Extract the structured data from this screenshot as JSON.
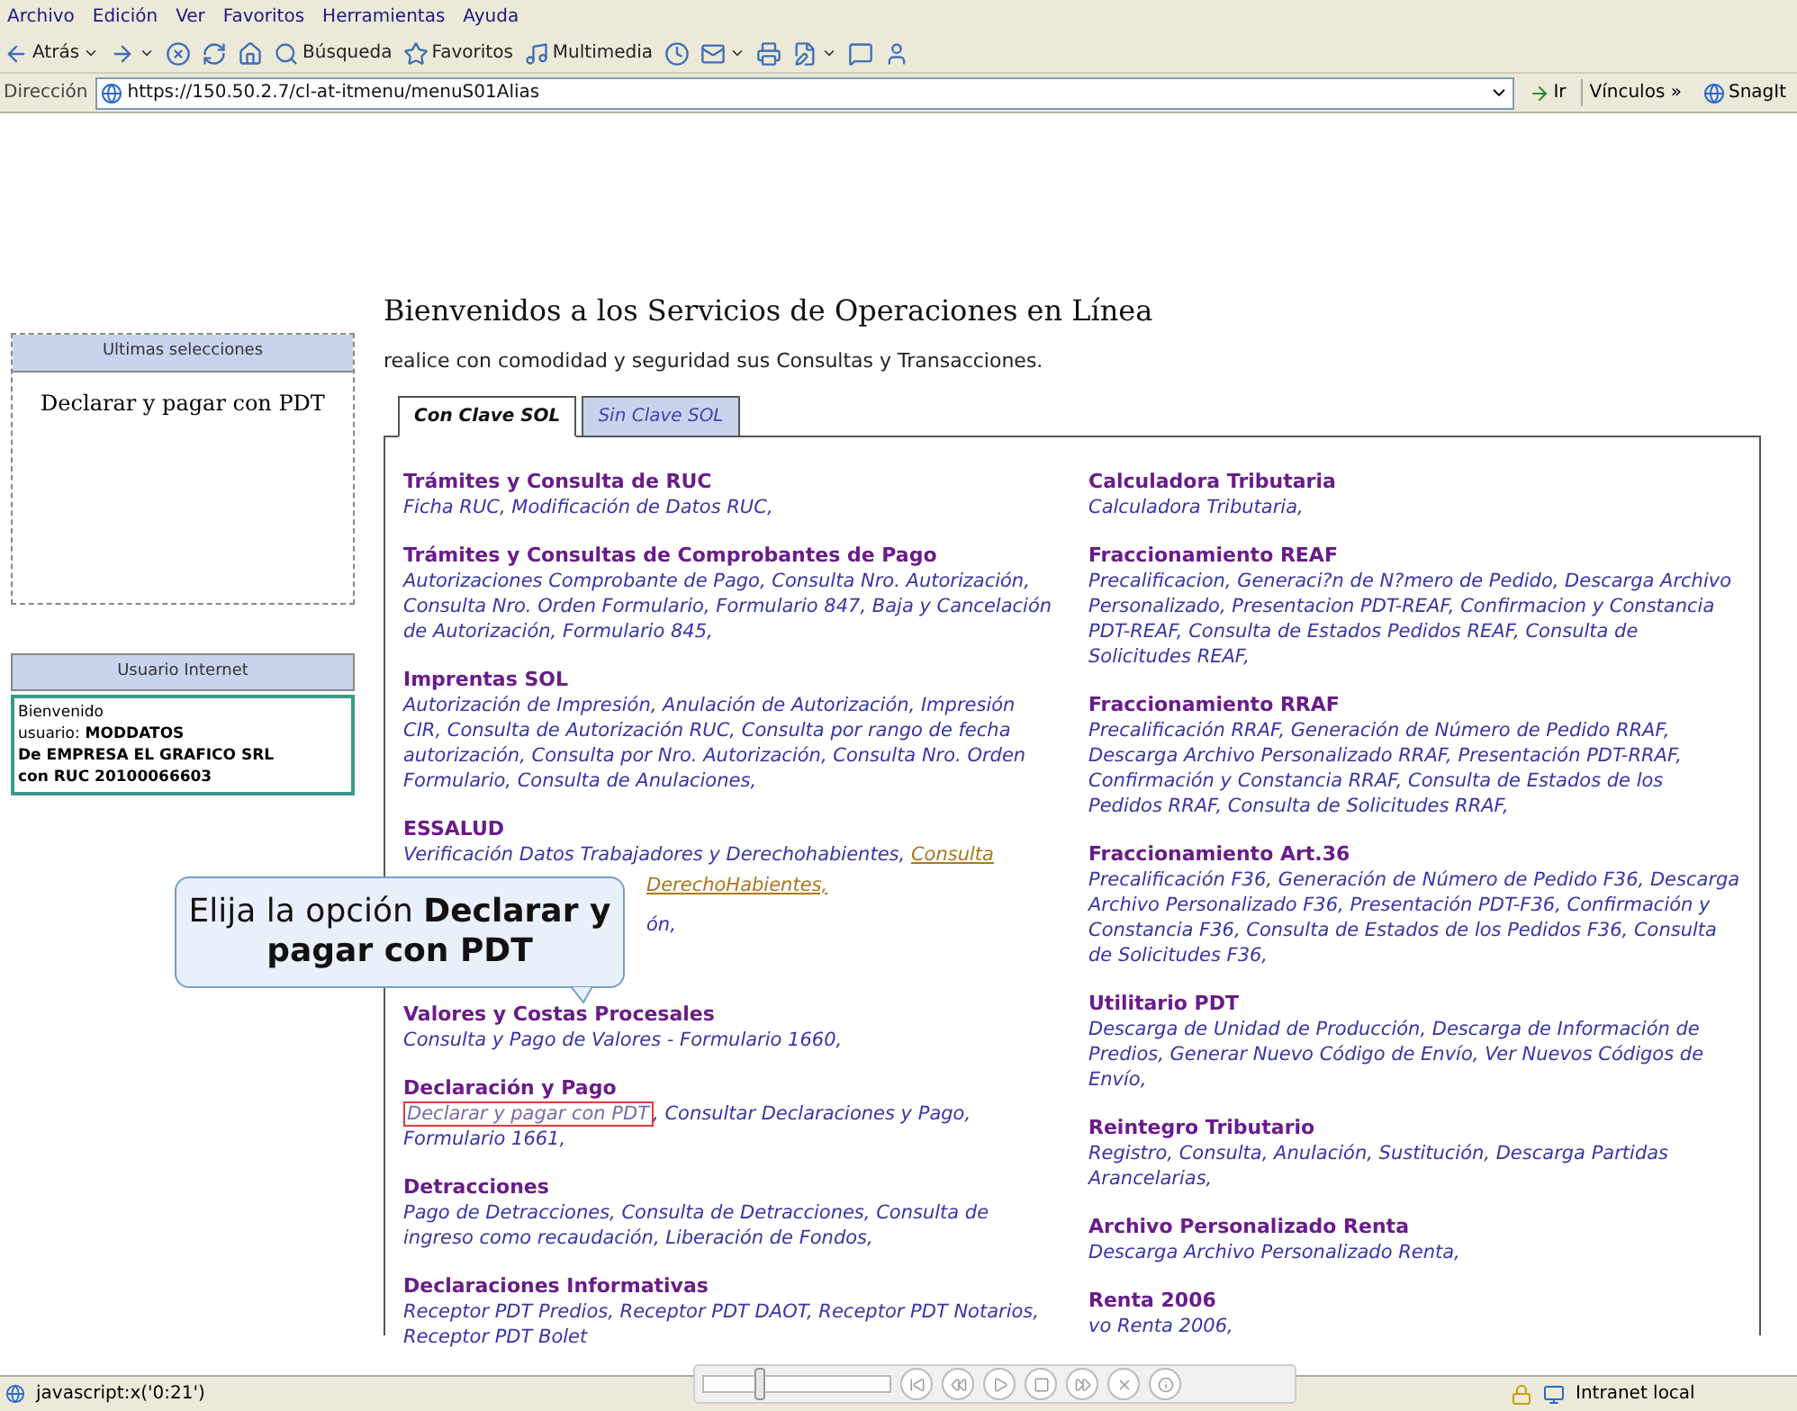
{
  "menu_bar": [
    "Archivo",
    "Edición",
    "Ver",
    "Favoritos",
    "Herramientas",
    "Ayuda"
  ],
  "toolbar": [
    {
      "label": "Atrás",
      "dropdown": true
    },
    {
      "dropdown": true
    },
    {
      "dropdown": false
    },
    {
      "dropdown": false
    },
    {
      "dropdown": false
    },
    {
      "label": "Búsqueda",
      "dropdown": false
    },
    {
      "label": "Favoritos",
      "dropdown": false
    },
    {
      "label": "Multimedia",
      "dropdown": false
    },
    {
      "dropdown": false
    },
    {
      "dropdown": true
    },
    {
      "dropdown": false
    },
    {
      "dropdown": true
    },
    {
      "dropdown": false
    },
    {
      "dropdown": false
    }
  ],
  "address_bar": {
    "label": "Dirección",
    "value": "https://150.50.2.7/cl-at-itmenu/menuS01Alias",
    "go": "Ir",
    "links": "Vínculos »",
    "snagit": "SnagIt"
  },
  "sidebar": {
    "recent": {
      "title": "Ultimas selecciones",
      "items": [
        "Declarar y pagar con PDT"
      ]
    },
    "user": {
      "title": "Usuario Internet",
      "lines": [
        {
          "label": "Bienvenido"
        },
        {
          "label": "usuario:",
          "value": "MODDATOS"
        },
        {
          "label": "De",
          "value": "EMPRESA EL GRAFICO SRL",
          "bold": true
        },
        {
          "label": "con RUC",
          "value": "20100066603",
          "bold": true
        }
      ]
    }
  },
  "page": {
    "title": "Bienvenidos a los Servicios de Operaciones en Línea",
    "subtitle": "realice con comodidad y seguridad sus Consultas y Transacciones.",
    "tabs": [
      {
        "label": "Con Clave SOL",
        "selected": true
      },
      {
        "label": "Sin Clave SOL",
        "selected": false
      }
    ],
    "columns": [
      [
        {
          "title": "Trámites y Consulta de RUC",
          "links": [
            {
              "kind": "link",
              "text": "Ficha RUC, Modificación de Datos RUC,"
            }
          ]
        },
        {
          "title": "Trámites y Consultas de Comprobantes de Pago",
          "links": [
            {
              "kind": "link",
              "text": "Autorizaciones Comprobante de Pago, Consulta Nro. Autorización, Consulta Nro. Orden Formulario, Formulario 847, Baja y Cancelación de Autorización, Formulario 845,"
            }
          ]
        },
        {
          "title": "Imprentas SOL",
          "links": [
            {
              "kind": "link",
              "text": "Autorización de Impresión, Anulación de Autorización, Impresión CIR, Consulta de Autorización RUC, Consulta por rango de fecha autorización, Consulta por Nro. Autorización, Consulta Nro. Orden Formulario, Consulta de Anulaciones,"
            }
          ]
        },
        {
          "title": "ESSALUD",
          "links": [
            {
              "kind": "link",
              "text": "Verificación Datos Trabajadores y Derechohabientes,"
            },
            {
              "kind": "visited",
              "text": "Consulta"
            }
          ]
        },
        {
          "kind": "fragment",
          "links": [
            {
              "kind": "visited",
              "text": "DerechoHabientes,"
            }
          ]
        },
        {
          "kind": "fragment",
          "links": [
            {
              "kind": "link",
              "text": "ón,"
            }
          ]
        },
        {
          "title": "Valores y Costas Procesales",
          "links": [
            {
              "kind": "link",
              "text": "Consulta y Pago de Valores - Formulario 1660,"
            }
          ]
        },
        {
          "title": "Declaración y Pago",
          "links": [
            {
              "kind": "boxed",
              "text": "Declarar y pagar con PDT"
            },
            {
              "kind": "link",
              "text": ", Consultar Declaraciones y Pago, Formulario 1661,"
            }
          ]
        },
        {
          "title": "Detracciones",
          "links": [
            {
              "kind": "link",
              "text": "Pago de Detracciones, Consulta de Detracciones, Consulta de ingreso como recaudación, Liberación de Fondos,"
            }
          ]
        },
        {
          "title": "Declaraciones Informativas",
          "links": [
            {
              "kind": "link",
              "text": "Receptor PDT Predios, Receptor PDT DAOT, Receptor PDT Notarios, Receptor PDT Bolet"
            }
          ]
        }
      ],
      [
        {
          "title": "Calculadora Tributaria",
          "links": [
            {
              "kind": "link",
              "text": "Calculadora Tributaria,"
            }
          ]
        },
        {
          "title": "Fraccionamiento REAF",
          "links": [
            {
              "kind": "link",
              "text": "Precalificacion, Generaci?n de N?mero de Pedido, Descarga Archivo Personalizado, Presentacion PDT-REAF, Confirmacion y Constancia PDT-REAF, Consulta de Estados Pedidos REAF, Consulta de Solicitudes REAF,"
            }
          ]
        },
        {
          "title": "Fraccionamiento RRAF",
          "links": [
            {
              "kind": "link",
              "text": "Precalificación RRAF, Generación de Número de Pedido RRAF, Descarga Archivo Personalizado RRAF, Presentación PDT-RRAF, Confirmación y Constancia RRAF, Consulta de Estados de los Pedidos RRAF, Consulta de Solicitudes RRAF,"
            }
          ]
        },
        {
          "title": "Fraccionamiento Art.36",
          "links": [
            {
              "kind": "link",
              "text": "Precalificación F36, Generación de Número de Pedido F36, Descarga Archivo Personalizado F36, Presentación PDT-F36, Confirmación y Constancia F36, Consulta de Estados de los Pedidos F36, Consulta de Solicitudes F36,"
            }
          ]
        },
        {
          "title": "Utilitario PDT",
          "links": [
            {
              "kind": "link",
              "text": "Descarga de Unidad de Producción, Descarga de Información de Predios, Generar Nuevo Código de Envío, Ver Nuevos Códigos de Envío,"
            }
          ]
        },
        {
          "title": "Reintegro Tributario",
          "links": [
            {
              "kind": "link",
              "text": "Registro, Consulta, Anulación, Sustitución, Descarga Partidas Arancelarias,"
            }
          ]
        },
        {
          "title": "Archivo Personalizado Renta",
          "links": [
            {
              "kind": "link",
              "text": "Descarga Archivo Personalizado Renta,"
            }
          ]
        },
        {
          "title": "Renta 2006",
          "links": [
            {
              "kind": "link",
              "text": "vo Renta 2006,"
            }
          ]
        }
      ]
    ]
  },
  "callout": {
    "text": "Elija la opción **Declarar y pagar con PDT**"
  },
  "player": {
    "level": 0.3
  },
  "status_bar": {
    "text": "javascript:x('0:21')",
    "zone": "Intranet local"
  }
}
